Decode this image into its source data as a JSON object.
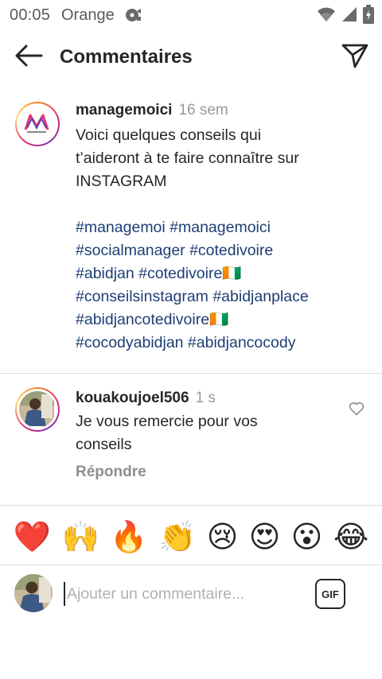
{
  "status_bar": {
    "time": "00:05",
    "carrier": "Orange",
    "icons": [
      "media-notification-icon",
      "wifi-icon",
      "signal-icon",
      "battery-charging-icon"
    ]
  },
  "header": {
    "title": "Commentaires",
    "back_icon": "arrow-left-icon",
    "share_icon": "paper-plane-icon"
  },
  "caption": {
    "username": "managemoici",
    "time": "16 sem",
    "text_lines": [
      "Voici quelques conseils qui",
      "t’aideront à te faire connaître sur",
      "INSTAGRAM"
    ],
    "hashtag_lines": [
      "#managemoi #managemoici",
      "#socialmanager #cotedivoire",
      "#abidjan #cotedivoire🇨🇮",
      "#conseilsinstagram #abidjanplace",
      "#abidjancotedivoire🇨🇮",
      "#cocodyabidjan #abidjancocody"
    ]
  },
  "comment": {
    "username": "kouakoujoel506",
    "time": "1 s",
    "text_lines": [
      "Je vous remercie pour vos",
      "conseils"
    ],
    "reply_label": "Répondre",
    "like_icon": "heart-outline-icon"
  },
  "emoji_bar": [
    "❤️",
    "🙌",
    "🔥",
    "👏",
    "😢",
    "😍",
    "😮",
    "😂"
  ],
  "composer": {
    "placeholder": "Ajouter un commentaire...",
    "gif_label": "GIF"
  },
  "colors": {
    "hashtag": "#1d3e74",
    "text": "#262626",
    "muted": "#8e8e8e",
    "divider": "#dbdbdb"
  }
}
